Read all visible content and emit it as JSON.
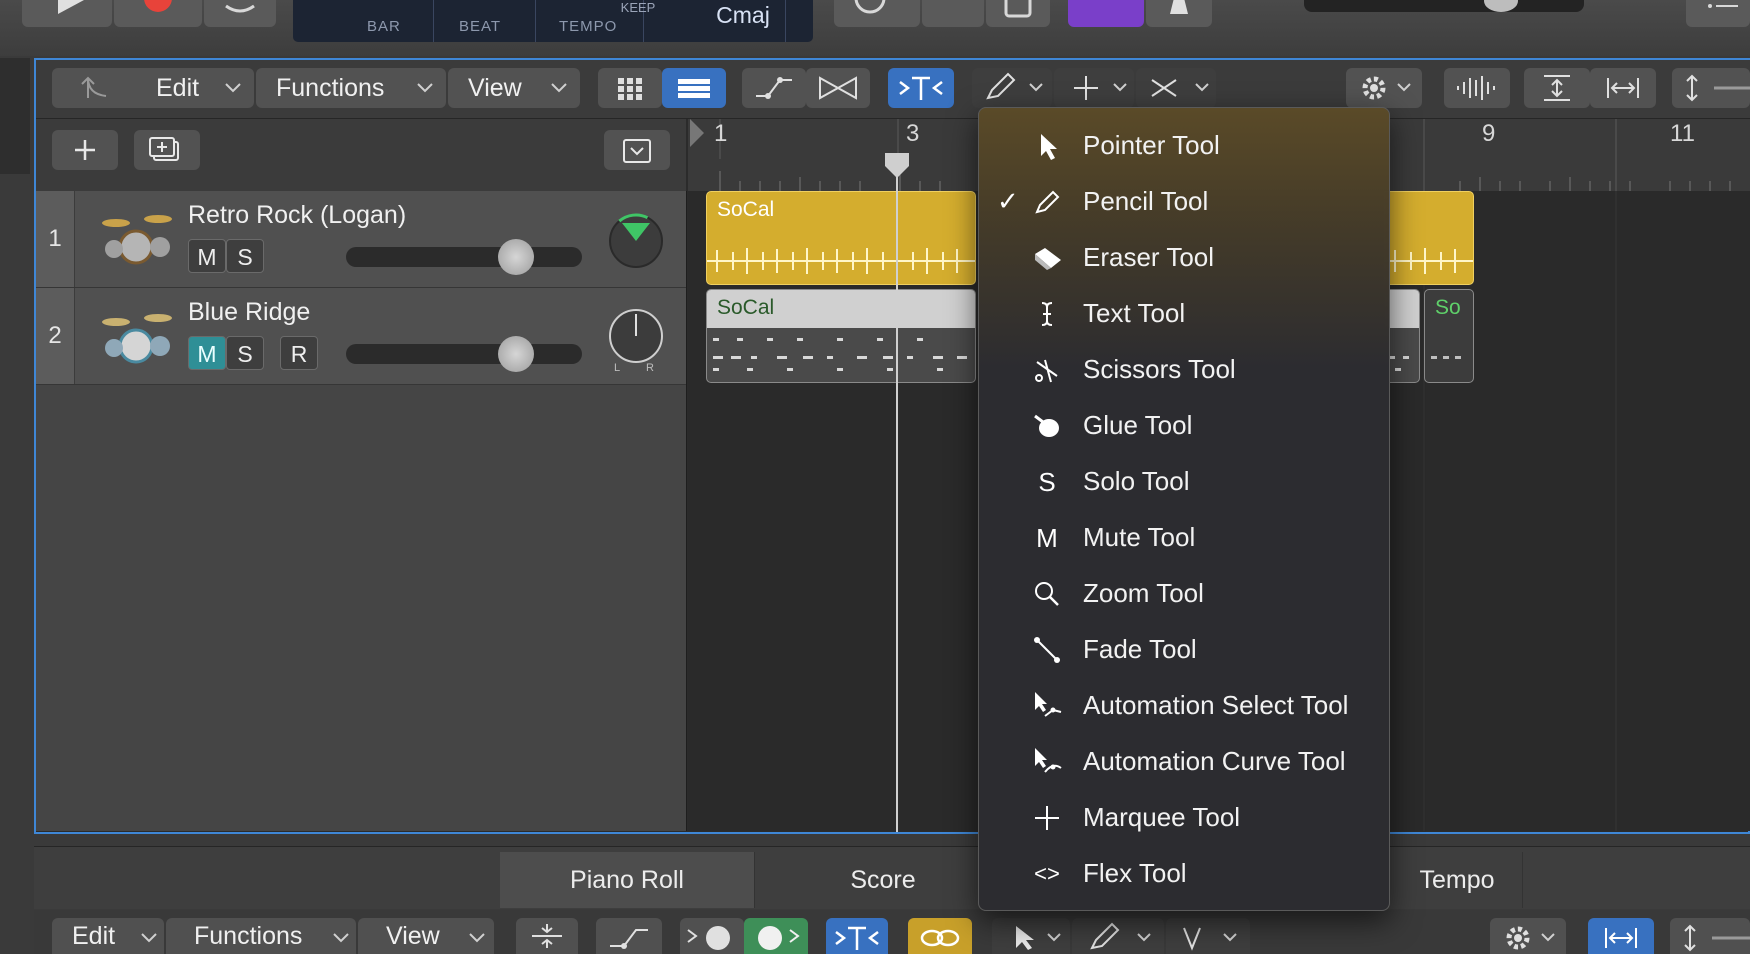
{
  "transport": {
    "bar_label": "BAR",
    "beat_label": "BEAT",
    "tempo_label": "TEMPO",
    "keep_label": "KEEP",
    "key": "Cmaj"
  },
  "toolbar": {
    "edit": "Edit",
    "functions": "Functions",
    "view": "View"
  },
  "ruler": {
    "marks": [
      "1",
      "3",
      "9",
      "11"
    ]
  },
  "tracks": [
    {
      "number": "1",
      "name": "Retro Rock (Logan)",
      "mute": "M",
      "solo": "S",
      "region": "SoCal"
    },
    {
      "number": "2",
      "name": "Blue Ridge",
      "mute": "M",
      "solo": "S",
      "record": "R",
      "region": "SoCal",
      "region2": "So",
      "pan_l": "L",
      "pan_r": "R"
    }
  ],
  "menu": {
    "items": [
      {
        "label": "Pointer Tool",
        "icon": "pointer-icon",
        "checked": false
      },
      {
        "label": "Pencil Tool",
        "icon": "pencil-icon",
        "checked": true
      },
      {
        "label": "Eraser Tool",
        "icon": "eraser-icon",
        "checked": false
      },
      {
        "label": "Text Tool",
        "icon": "text-cursor-icon",
        "checked": false
      },
      {
        "label": "Scissors Tool",
        "icon": "scissors-icon",
        "checked": false
      },
      {
        "label": "Glue Tool",
        "icon": "glue-icon",
        "checked": false
      },
      {
        "label": "Solo Tool",
        "icon": "solo-icon",
        "glyph": "S",
        "checked": false
      },
      {
        "label": "Mute Tool",
        "icon": "mute-icon",
        "glyph": "M",
        "checked": false
      },
      {
        "label": "Zoom Tool",
        "icon": "zoom-icon",
        "checked": false
      },
      {
        "label": "Fade Tool",
        "icon": "fade-icon",
        "checked": false
      },
      {
        "label": "Automation Select Tool",
        "icon": "automation-select-icon",
        "checked": false
      },
      {
        "label": "Automation Curve Tool",
        "icon": "automation-curve-icon",
        "checked": false
      },
      {
        "label": "Marquee Tool",
        "icon": "marquee-icon",
        "checked": false
      },
      {
        "label": "Flex Tool",
        "icon": "flex-icon",
        "glyph": "<>",
        "checked": false
      }
    ],
    "check_glyph": "✓"
  },
  "bottom": {
    "tabs": [
      "Piano Roll",
      "Score",
      "Tempo"
    ],
    "edit": "Edit",
    "functions": "Functions",
    "view": "View"
  },
  "colors": {
    "accent_blue": "#3871c0",
    "region_audio": "#d4ad2e",
    "mute_on": "#2f8f96"
  }
}
